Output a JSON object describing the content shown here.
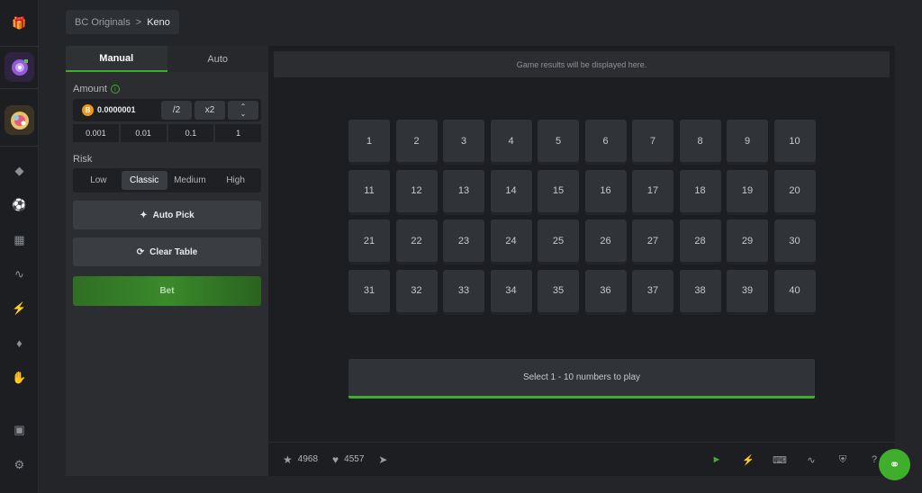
{
  "breadcrumb": {
    "parent": "BC Originals",
    "separator": ">",
    "current": "Keno"
  },
  "panel": {
    "tabs": [
      {
        "label": "Manual",
        "active": true
      },
      {
        "label": "Auto",
        "active": false
      }
    ],
    "amount_label": "Amount",
    "amount_value": "0.0000001",
    "amount_buttons": {
      "half": "/2",
      "double": "x2"
    },
    "quick_amounts": [
      "0.001",
      "0.01",
      "0.1",
      "1"
    ],
    "risk_label": "Risk",
    "risk_options": [
      "Low",
      "Classic",
      "Medium",
      "High"
    ],
    "risk_selected": "Classic",
    "auto_pick_label": "Auto Pick",
    "clear_table_label": "Clear Table",
    "bet_label": "Bet"
  },
  "game": {
    "results_placeholder": "Game results will be displayed here.",
    "numbers": [
      "1",
      "2",
      "3",
      "4",
      "5",
      "6",
      "7",
      "8",
      "9",
      "10",
      "11",
      "12",
      "13",
      "14",
      "15",
      "16",
      "17",
      "18",
      "19",
      "20",
      "21",
      "22",
      "23",
      "24",
      "25",
      "26",
      "27",
      "28",
      "29",
      "30",
      "31",
      "32",
      "33",
      "34",
      "35",
      "36",
      "37",
      "38",
      "39",
      "40"
    ],
    "select_hint": "Select 1 - 10 numbers to play"
  },
  "footer": {
    "favorites": "4968",
    "likes": "4557"
  },
  "colors": {
    "accent": "#3fae2c",
    "coin": "#f0961a",
    "background": "#232528",
    "panel": "#2b2d31"
  },
  "icons": {
    "rail": [
      "gift-icon",
      "game-candy-icon",
      "game-wheel-icon",
      "crypto-icon",
      "sports-ball-icon",
      "chart-bars-icon",
      "pulse-icon",
      "lightning-icon",
      "ticket-icon",
      "hand-icon",
      "treasure-icon",
      "settings-icon"
    ],
    "footer": [
      "star-icon",
      "heart-icon",
      "telegram-icon",
      "sound-icon",
      "lightning-icon",
      "keyboard-icon",
      "graph-icon",
      "shield-icon",
      "help-icon",
      "headset-icon"
    ]
  }
}
